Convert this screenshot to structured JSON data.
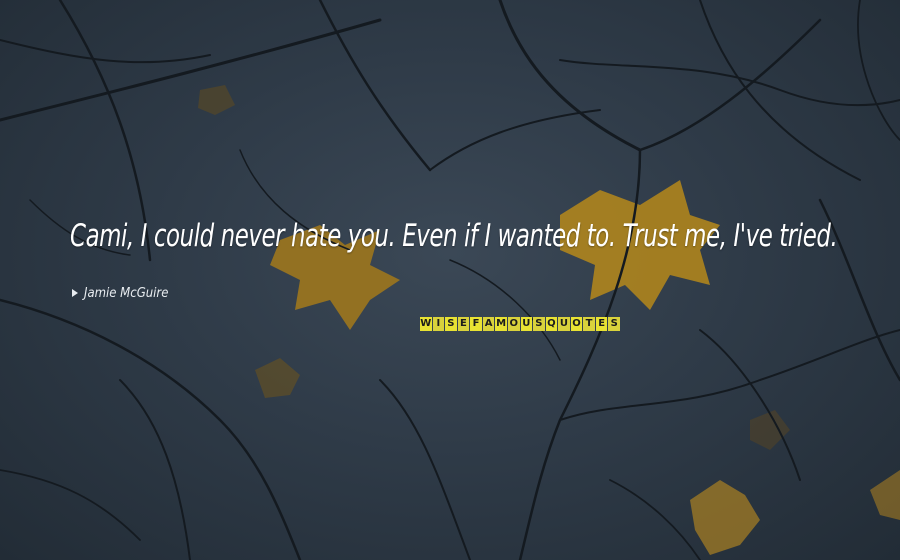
{
  "quote": {
    "text": "Cami, I could never hate you. Even if I wanted to. Trust me, I've tried.",
    "author": "Jamie McGuire"
  },
  "logo": {
    "letters": [
      "W",
      "I",
      "S",
      "E",
      "F",
      "A",
      "M",
      "O",
      "U",
      "S",
      "Q",
      "U",
      "O",
      "T",
      "E",
      "S"
    ]
  },
  "icons": {
    "author": "chevron-right-icon"
  },
  "colors": {
    "background": "#2f3b48",
    "quote_text": "#ffffff",
    "logo_yellow": "#e8e233",
    "leaf_yellow": "#b58a1c",
    "branch": "#141a20"
  }
}
